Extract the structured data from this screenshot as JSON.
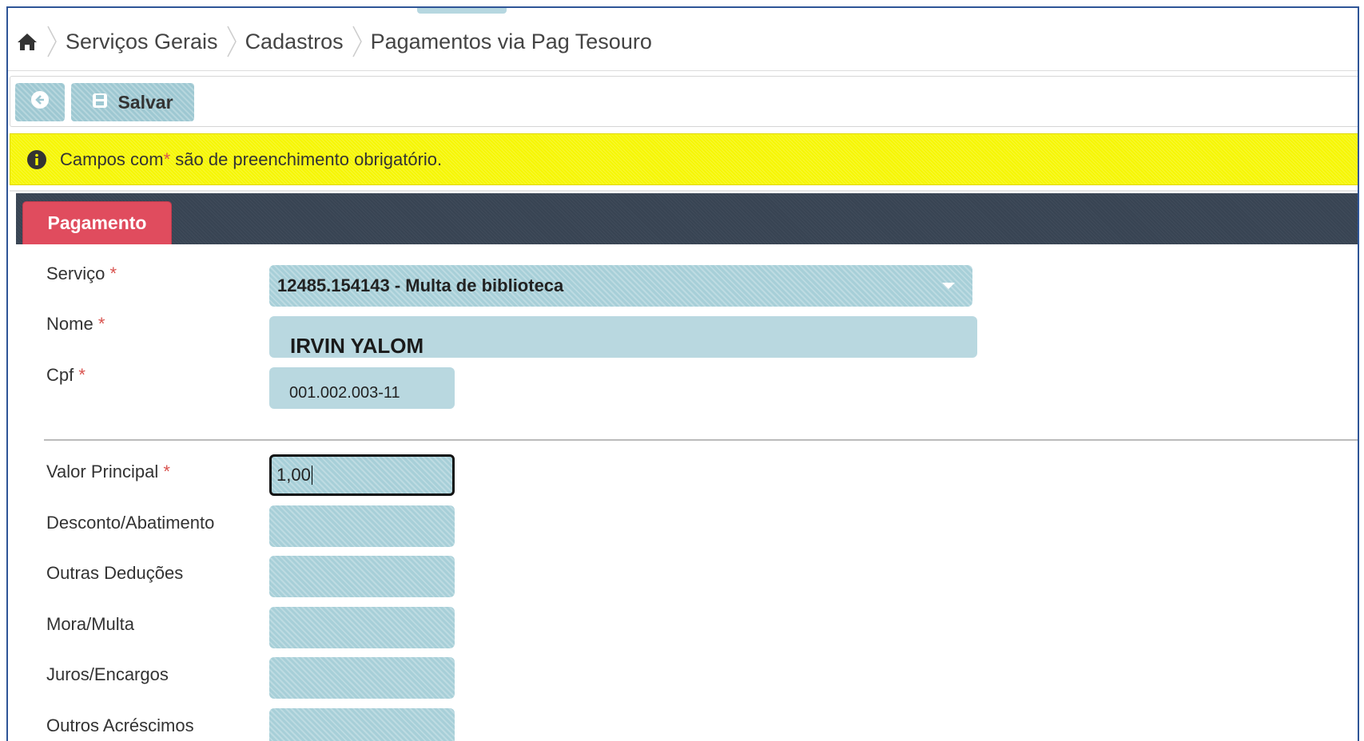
{
  "breadcrumb": {
    "items": [
      "Serviços Gerais",
      "Cadastros",
      "Pagamentos via Pag Tesouro"
    ]
  },
  "toolbar": {
    "save_label": "Salvar"
  },
  "alert": {
    "text_before": "Campos com ",
    "star": "*",
    "text_after": " são de preenchimento obrigatório."
  },
  "tabs": {
    "active_label": "Pagamento"
  },
  "form": {
    "servico": {
      "label": "Serviço",
      "star": "*",
      "value": "12485.154143 - Multa de biblioteca"
    },
    "nome": {
      "label": "Nome",
      "star": "*",
      "value": "IRVIN YALOM"
    },
    "cpf": {
      "label": "Cpf",
      "star": "*",
      "value": "001.002.003-11"
    },
    "valor_principal": {
      "label": "Valor Principal",
      "star": "*",
      "value": "1,00"
    },
    "desconto": {
      "label": "Desconto/Abatimento",
      "value": ""
    },
    "outras_deducoes": {
      "label": "Outras Deduções",
      "value": ""
    },
    "mora_multa": {
      "label": "Mora/Multa",
      "value": ""
    },
    "juros_encargos": {
      "label": "Juros/Encargos",
      "value": ""
    },
    "outros_acrescimos": {
      "label": "Outros Acréscimos",
      "value": ""
    }
  },
  "colors": {
    "accent_tab": "#e04c5e",
    "tabbar": "#384453",
    "field": "#a7cfd8",
    "alert": "#f6f606",
    "required_star": "#d9534f"
  },
  "icons": [
    "home-icon",
    "back-arrow-icon",
    "save-icon",
    "info-icon",
    "chevron-down-icon"
  ]
}
